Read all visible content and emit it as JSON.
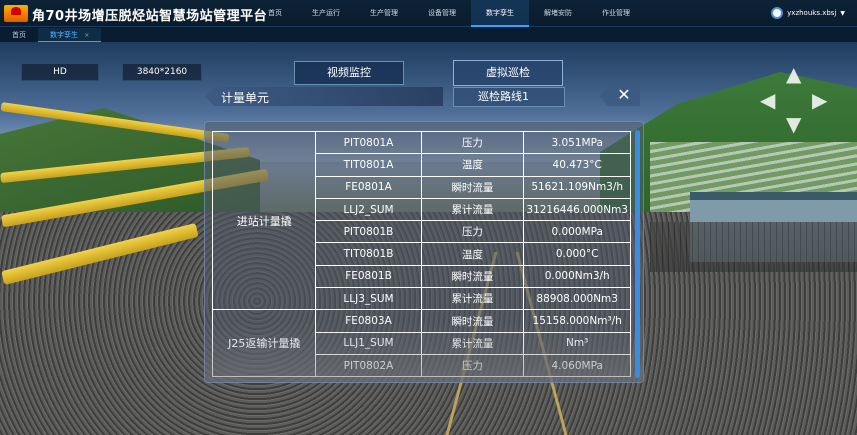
{
  "app": {
    "title": "角70井场增压脱烃站智慧场站管理平台"
  },
  "nav": [
    "首页",
    "生产运行",
    "生产管理",
    "设备管理",
    "数字孪生",
    "解堵安防",
    "作业管理"
  ],
  "nav_active_index": 4,
  "user": {
    "name": "yxzhouks.xbsj"
  },
  "tabs": [
    {
      "label": "首页"
    },
    {
      "label": "数字孪生",
      "close": "×"
    }
  ],
  "hud": {
    "quality": "HD",
    "resolution": "3840*2160",
    "video_btn": "视频监控",
    "patrol_btn": "虚拟巡检",
    "unit_label": "计量单元",
    "route": "巡检路线1",
    "close": "✕"
  },
  "dpad": {
    "up": "▲",
    "down": "▼",
    "left": "◀",
    "right": "▶"
  },
  "table": {
    "groups": [
      {
        "name": "进站计量撬",
        "rows": [
          {
            "tag": "PIT0801A",
            "param": "压力",
            "value": "3.051MPa"
          },
          {
            "tag": "TIT0801A",
            "param": "温度",
            "value": "40.473°C"
          },
          {
            "tag": "FE0801A",
            "param": "瞬时流量",
            "value": "51621.109Nm3/h"
          },
          {
            "tag": "LLJ2_SUM",
            "param": "累计流量",
            "value": "31216446.000Nm3"
          },
          {
            "tag": "PIT0801B",
            "param": "压力",
            "value": "0.000MPa"
          },
          {
            "tag": "TIT0801B",
            "param": "温度",
            "value": "0.000°C"
          },
          {
            "tag": "FE0801B",
            "param": "瞬时流量",
            "value": "0.000Nm3/h"
          },
          {
            "tag": "LLJ3_SUM",
            "param": "累计流量",
            "value": "88908.000Nm3"
          }
        ]
      },
      {
        "name": "J25返输计量撬",
        "rows": [
          {
            "tag": "FE0803A",
            "param": "瞬时流量",
            "value": "15158.000Nm³/h"
          },
          {
            "tag": "LLJ1_SUM",
            "param": "累计流量",
            "value": "Nm³"
          },
          {
            "tag": "PIT0802A",
            "param": "压力",
            "value": "4.060MPa"
          }
        ]
      }
    ]
  },
  "colors": {
    "accent": "#3aa0ff",
    "header_bg": "#0d2236"
  }
}
